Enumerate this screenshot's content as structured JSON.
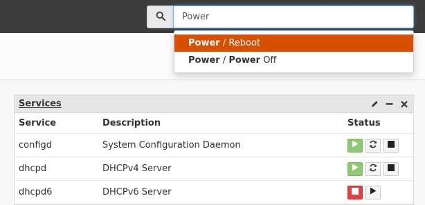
{
  "search": {
    "value": "Power",
    "suggestions": [
      {
        "match": "Power",
        "rest": " / Reboot",
        "active": true
      },
      {
        "match": "Power",
        "mid": " / ",
        "match2": "Power",
        "rest": " Off",
        "active": false
      }
    ]
  },
  "widget": {
    "title": "Services",
    "columns": [
      "Service",
      "Description",
      "Status"
    ],
    "rows": [
      {
        "service": "configd",
        "description": "System Configuration Daemon",
        "status": "running"
      },
      {
        "service": "dhcpd",
        "description": "DHCPv4 Server",
        "status": "running"
      },
      {
        "service": "dhcpd6",
        "description": "DHCPv6 Server",
        "status": "stopped"
      }
    ]
  },
  "colors": {
    "topbar": "#3c3c3c",
    "highlight": "#d94f00",
    "running": "#8fc772",
    "stopped": "#e24141"
  },
  "icons": [
    "search-icon",
    "pencil-icon",
    "minus-icon",
    "close-icon",
    "play-icon",
    "restart-icon",
    "stop-icon"
  ]
}
